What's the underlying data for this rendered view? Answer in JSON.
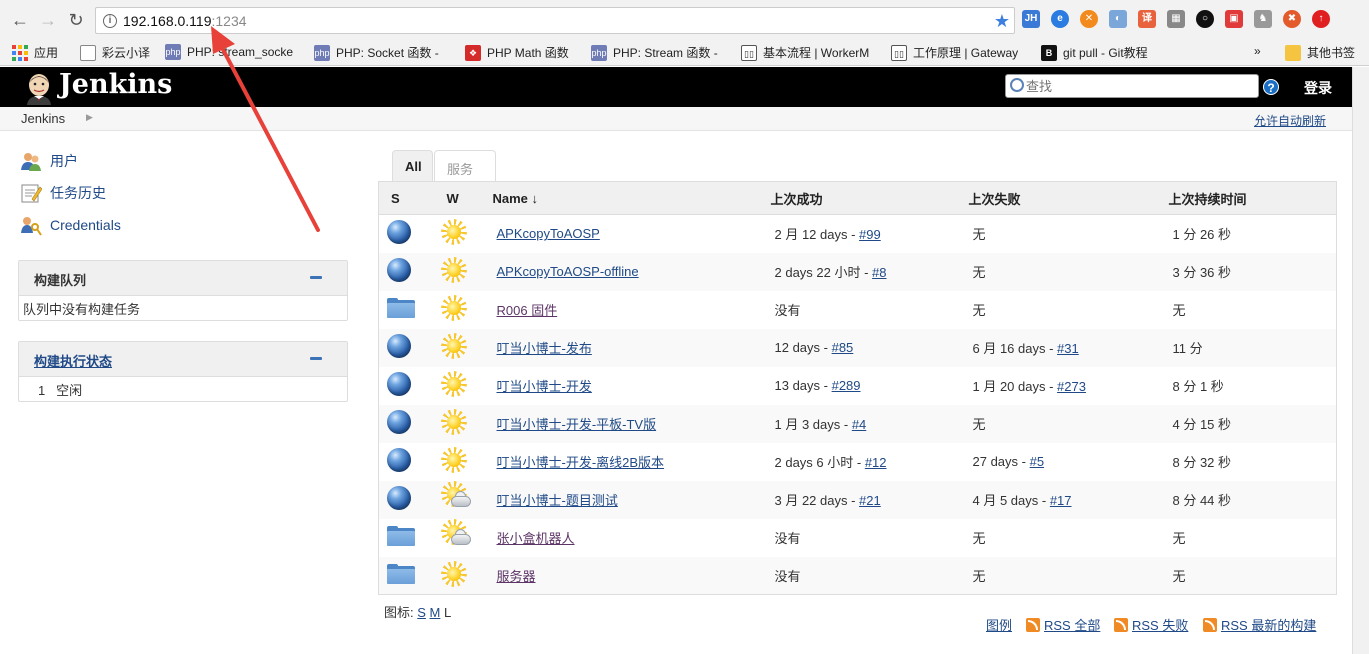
{
  "browser": {
    "url_host": "192.168.0.119",
    "url_port": ":1234",
    "bookmarks": [
      {
        "label": "应用"
      },
      {
        "label": "彩云小译"
      },
      {
        "label": "PHP: stream_socke"
      },
      {
        "label": "PHP: Socket 函数 -"
      },
      {
        "label": "PHP Math 函数"
      },
      {
        "label": "PHP: Stream 函数 -"
      },
      {
        "label": "基本流程 | WorkerM"
      },
      {
        "label": "工作原理 | Gateway"
      },
      {
        "label": "git pull - Git教程"
      },
      {
        "label": "其他书签"
      }
    ],
    "overflow_label": "»"
  },
  "header": {
    "title": "Jenkins",
    "search_placeholder": "查找",
    "help_label": "?",
    "login_label": "登录"
  },
  "breadcrumb": {
    "root": "Jenkins",
    "auto_refresh": "允许自动刷新"
  },
  "sidebar": {
    "tasks": [
      {
        "label": "用户"
      },
      {
        "label": "任务历史"
      },
      {
        "label": "Credentials"
      }
    ],
    "build_queue": {
      "title": "构建队列",
      "empty_text": "队列中没有构建任务"
    },
    "executors": {
      "title": "构建执行状态",
      "rows": [
        {
          "num": "1",
          "status": "空闲"
        }
      ]
    }
  },
  "tabs": [
    {
      "label": "All",
      "active": true
    },
    {
      "label": "服务器",
      "active": false
    }
  ],
  "table": {
    "headers": {
      "s": "S",
      "w": "W",
      "name": "Name ↓",
      "last_success": "上次成功",
      "last_failure": "上次失败",
      "last_duration": "上次持续时间"
    },
    "rows": [
      {
        "type": "job",
        "weather": "sun",
        "name": "APKcopyToAOSP",
        "succ_text": "2 月 12 days - ",
        "succ_link": "#99",
        "fail_text": "无",
        "fail_link": "",
        "duration": "1 分 26 秒"
      },
      {
        "type": "job",
        "weather": "sun",
        "name": "APKcopyToAOSP-offline",
        "succ_text": "2 days 22 小时 - ",
        "succ_link": "#8",
        "fail_text": "无",
        "fail_link": "",
        "duration": "3 分 36 秒"
      },
      {
        "type": "folder",
        "weather": "sun",
        "name": "R006 固件",
        "succ_text": "没有",
        "succ_link": "",
        "fail_text": "无",
        "fail_link": "",
        "duration": "无"
      },
      {
        "type": "job",
        "weather": "sun",
        "name": "叮当小博士-发布",
        "succ_text": "12 days - ",
        "succ_link": "#85",
        "fail_text": "6 月 16 days - ",
        "fail_link": "#31",
        "duration": "11 分"
      },
      {
        "type": "job",
        "weather": "sun",
        "name": "叮当小博士-开发",
        "succ_text": "13 days - ",
        "succ_link": "#289",
        "fail_text": "1 月 20 days - ",
        "fail_link": "#273",
        "duration": "8 分 1 秒"
      },
      {
        "type": "job",
        "weather": "sun",
        "name": "叮当小博士-开发-平板-TV版",
        "succ_text": "1 月 3 days - ",
        "succ_link": "#4",
        "fail_text": "无",
        "fail_link": "",
        "duration": "4 分 15 秒"
      },
      {
        "type": "job",
        "weather": "sun",
        "name": "叮当小博士-开发-离线2B版本",
        "succ_text": "2 days 6 小时 - ",
        "succ_link": "#12",
        "fail_text": "27 days - ",
        "fail_link": "#5",
        "duration": "8 分 32 秒"
      },
      {
        "type": "job",
        "weather": "cloud",
        "name": "叮当小博士-题目测试",
        "succ_text": "3 月 22 days - ",
        "succ_link": "#21",
        "fail_text": "4 月 5 days - ",
        "fail_link": "#17",
        "duration": "8 分 44 秒"
      },
      {
        "type": "folder",
        "weather": "cloud",
        "name": "张小盒机器人",
        "succ_text": "没有",
        "succ_link": "",
        "fail_text": "无",
        "fail_link": "",
        "duration": "无"
      },
      {
        "type": "folder",
        "weather": "sun",
        "name": "服务器",
        "succ_text": "没有",
        "succ_link": "",
        "fail_text": "无",
        "fail_link": "",
        "duration": "无"
      }
    ]
  },
  "icon_size": {
    "label": "图标: ",
    "s": "S",
    "m": "M",
    "l": "L"
  },
  "footer": {
    "legend": "图例",
    "rss_all": "RSS 全部",
    "rss_failed": "RSS 失败",
    "rss_latest": "RSS 最新的构建"
  },
  "colors": {
    "link": "#204a87",
    "header_bg": "#000000",
    "annotation_arrow": "#e8413a"
  }
}
